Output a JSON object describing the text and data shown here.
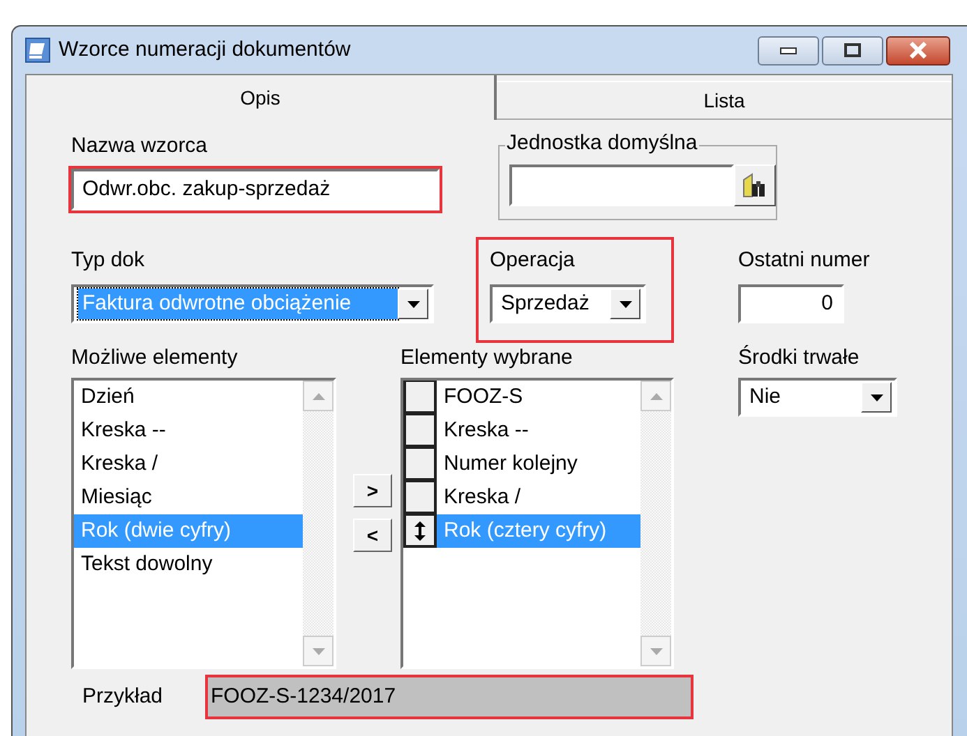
{
  "window": {
    "title": "Wzorce numeracji dokumentów"
  },
  "tabs": [
    {
      "label": "Opis",
      "selected": true
    },
    {
      "label": "Lista",
      "selected": false
    }
  ],
  "nazwa_wzorca": {
    "label": "Nazwa wzorca",
    "value": "Odwr.obc. zakup-sprzedaż",
    "highlighted": true
  },
  "jednostka_domyslna": {
    "label": "Jednostka domyślna"
  },
  "typ_dok": {
    "label": "Typ dok",
    "value": "Faktura odwrotne obciążenie"
  },
  "operacja": {
    "label": "Operacja",
    "value": "Sprzedaż",
    "highlighted": true
  },
  "ostatni_numer": {
    "label": "Ostatni numer",
    "value": "0"
  },
  "mozliwe_elementy": {
    "label": "Możliwe elementy",
    "items": [
      {
        "text": "Dzień",
        "selected": false
      },
      {
        "text": "Kreska --",
        "selected": false
      },
      {
        "text": "Kreska /",
        "selected": false
      },
      {
        "text": "Miesiąc",
        "selected": false
      },
      {
        "text": "Rok (dwie cyfry)",
        "selected": true
      },
      {
        "text": "Tekst dowolny",
        "selected": false
      }
    ]
  },
  "move_buttons": [
    ">",
    "<"
  ],
  "elementy_wybrane": {
    "label": "Elementy wybrane",
    "items": [
      {
        "text": "FOOZ-S",
        "selected": false
      },
      {
        "text": "Kreska --",
        "selected": false
      },
      {
        "text": "Numer kolejny",
        "selected": false
      },
      {
        "text": "Kreska /",
        "selected": false
      },
      {
        "text": "Rok (cztery cyfry)",
        "selected": true
      }
    ]
  },
  "srodki_trwale": {
    "label": "Środki trwałe",
    "value": "Nie"
  },
  "przyklad": {
    "label": "Przykład",
    "value": "FOOZ-S-1234/2017",
    "highlighted": true
  }
}
